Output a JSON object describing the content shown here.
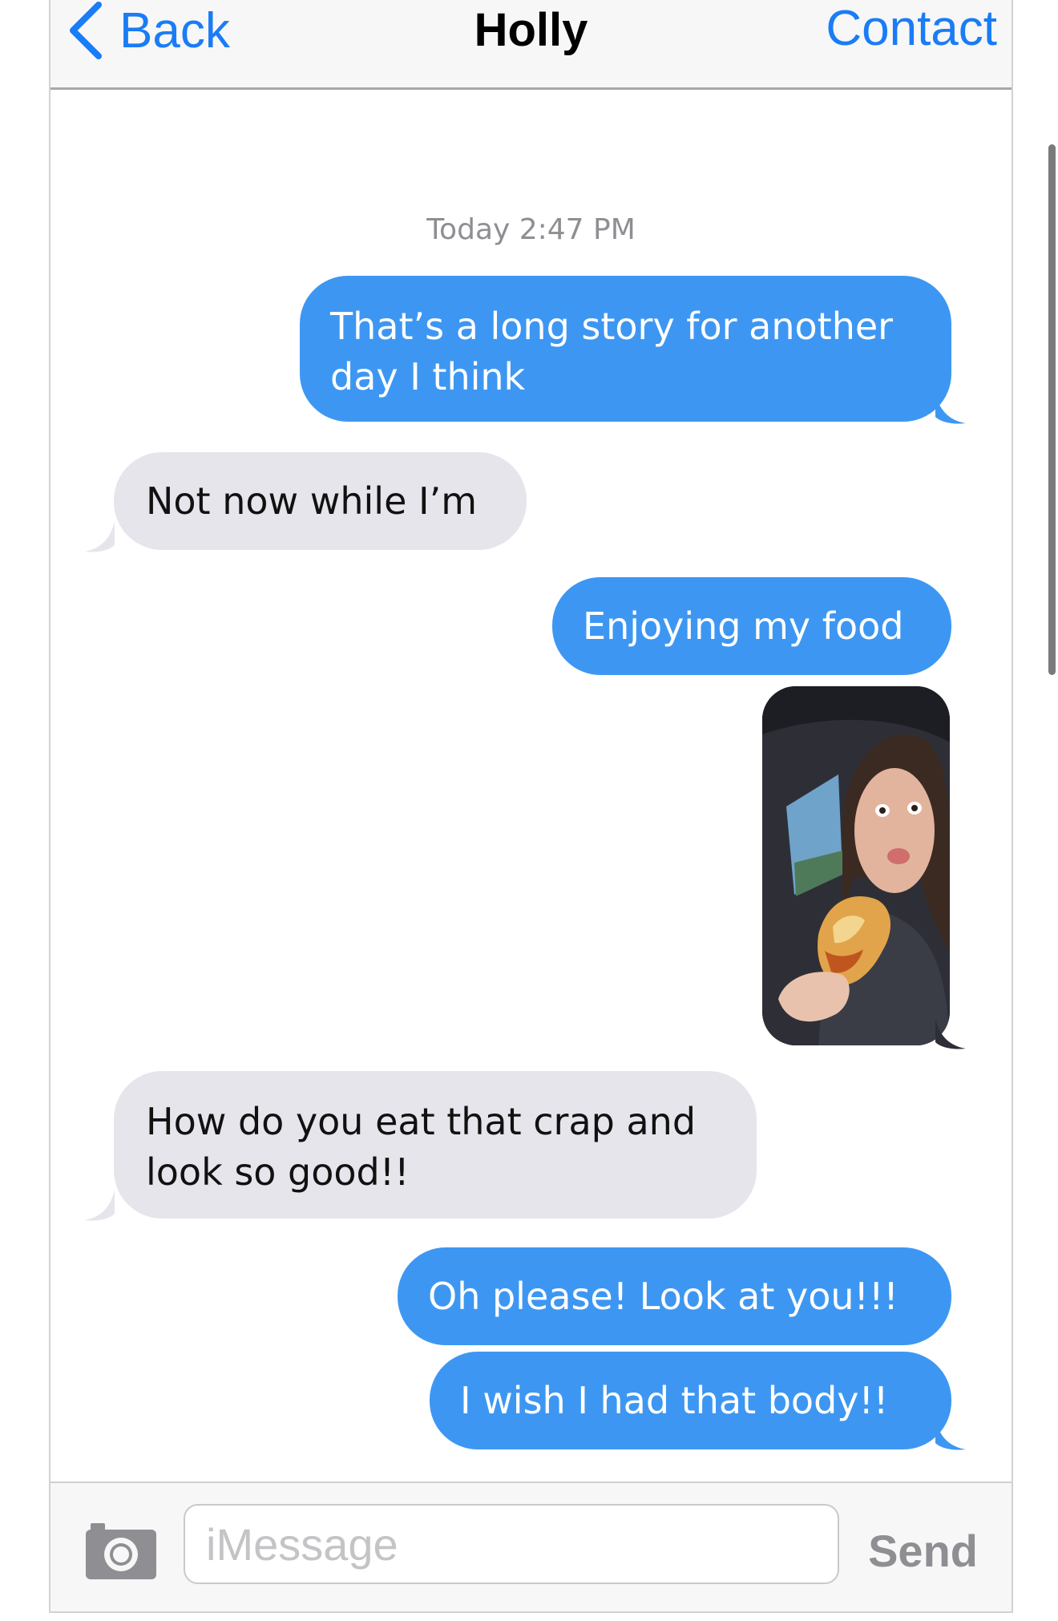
{
  "nav": {
    "back_label": "Back",
    "title": "Holly",
    "contact_label": "Contact"
  },
  "timestamp": "Today 2:47 PM",
  "messages": [
    {
      "direction": "outgoing",
      "text": "That’s a long story for another\nday I think"
    },
    {
      "direction": "incoming",
      "text": "Not now while I’m"
    },
    {
      "direction": "outgoing",
      "text": "Enjoying my food"
    },
    {
      "direction": "outgoing",
      "type": "photo"
    },
    {
      "direction": "incoming",
      "text": "How do you eat that crap and\nlook so good!!"
    },
    {
      "direction": "outgoing",
      "text": "Oh please! Look at you!!!"
    },
    {
      "direction": "outgoing",
      "text": "I wish I had that body!!"
    }
  ],
  "input": {
    "placeholder": "iMessage",
    "value": "",
    "send_label": "Send"
  },
  "icons": {
    "back": "chevron-left-icon",
    "camera": "camera-icon"
  },
  "colors": {
    "accent": "#1a7cf6",
    "outgoing_bubble": "#3d97f2",
    "incoming_bubble": "#e6e5eb"
  }
}
